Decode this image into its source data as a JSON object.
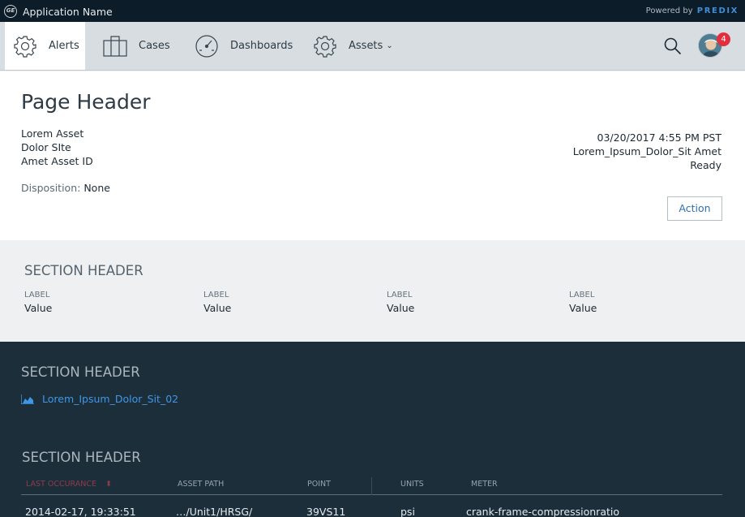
{
  "app": {
    "logo_text": "GE",
    "name": "Application Name",
    "powered_by": "Powered by",
    "brand": "PREDIX"
  },
  "nav": {
    "items": [
      {
        "label": "Alerts",
        "icon": "gear-icon",
        "active": true
      },
      {
        "label": "Cases",
        "icon": "map-icon",
        "active": false
      },
      {
        "label": "Dashboards",
        "icon": "gauge-icon",
        "active": false
      },
      {
        "label": "Assets",
        "icon": "gear-icon",
        "active": false,
        "dropdown": true
      }
    ],
    "caret": "⌄",
    "notification_count": "4"
  },
  "page_header": {
    "title": "Page Header",
    "lines": [
      "Lorem Asset",
      "Dolor SIte",
      "Amet Asset ID"
    ],
    "disposition_label": "Disposition:",
    "disposition_value": "None",
    "right_lines": [
      "03/20/2017 4:55 PM PST",
      "Lorem_Ipsum_Dolor_Sit Amet",
      "Ready"
    ],
    "action_label": "Action"
  },
  "section_light": {
    "title": "SECTION HEADER",
    "fields": [
      {
        "label": "LABEL",
        "value": "Value"
      },
      {
        "label": "LABEL",
        "value": "Value"
      },
      {
        "label": "LABEL",
        "value": "Value"
      },
      {
        "label": "LABEL",
        "value": "Value"
      }
    ]
  },
  "section_dark_1": {
    "title": "SECTION HEADER",
    "link_label": "Lorem_Ipsum_Dolor_Sit_02"
  },
  "section_dark_2": {
    "title": "SECTION HEADER",
    "columns": [
      "LAST OCCURANCE",
      "ASSET PATH",
      "POINT",
      "UNITS",
      "METER"
    ],
    "sort_glyph": "⬍",
    "rows": [
      [
        "2014-02-17, 19:33:51",
        "…/Unit1/HRSG/",
        "39VS11",
        "psi",
        "crank-frame-compressionratio"
      ]
    ]
  },
  "colors": {
    "appbar": "#0c1c28",
    "nav": "#d8dde1",
    "accent_link": "#3e97e6",
    "dark_section": "#1d2e3b",
    "badge": "#e22f3d",
    "brand": "#3f8fd8"
  }
}
